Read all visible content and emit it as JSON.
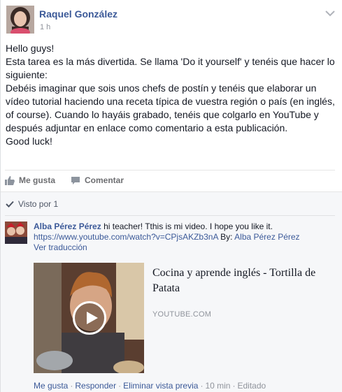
{
  "post": {
    "author": "Raquel González",
    "time": "1 h",
    "body": [
      "Hello guys!",
      "Esta tarea es la más divertida. Se llama 'Do it yourself' y tenéis que hacer lo siguiente:",
      "Debéis imaginar que sois unos chefs de postín y tenéis que elaborar un vídeo tutorial haciendo una receta típica de vuestra región o país (en inglés, of course). Cuando lo hayáis grabado, tenéis que colgarlo en YouTube y después adjuntar en enlace como comentario a esta publicación.",
      "Good luck!"
    ],
    "icons": {
      "options": "chevron-down-icon",
      "like": "thumbs-up-icon",
      "comment": "speech-bubble-icon",
      "seen": "checkmark-icon",
      "play": "play-icon"
    }
  },
  "actions": {
    "like_label": "Me gusta",
    "comment_label": "Comentar"
  },
  "seen_by": "Visto por 1",
  "comment": {
    "author": "Alba Pérez Pérez",
    "text": "hi teacher! Tthis is mi video. I hope you like it.",
    "link": "https://www.youtube.com/watch?v=CPjsAKZb3nA",
    "by_label": "By:",
    "by_author": "Alba Pérez Pérez",
    "translate": "Ver traducción",
    "preview": {
      "title": "Cocina y aprende inglés - Tortilla de Patata",
      "domain": "YOUTUBE.COM"
    },
    "meta": {
      "like": "Me gusta",
      "reply": "Responder",
      "remove_preview": "Eliminar vista previa",
      "time": "10 min",
      "edited": "Editado"
    }
  },
  "colors": {
    "link": "#3b5998",
    "muted": "#90949c",
    "feedback_bg": "#f6f7f9"
  }
}
